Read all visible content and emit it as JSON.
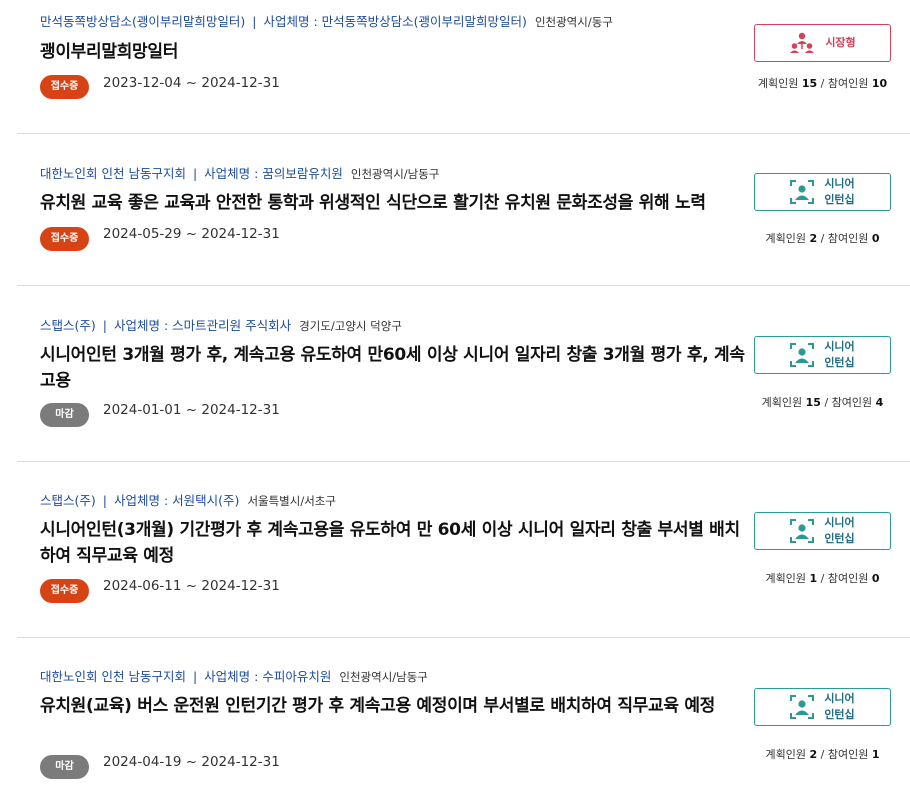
{
  "items": [
    {
      "org": "만석동쪽방상담소(괭이부리말희망일터)",
      "company_label": "사업체명",
      "company": "만석동쪽방상담소(괭이부리말희망일터)",
      "region": "인천광역시/동구",
      "title": "괭이부리말희망일터",
      "status": "접수중",
      "period": "2023-12-04 ~ 2024-12-31",
      "type": "시장형",
      "planned_label": "계획인원",
      "planned": "15",
      "joined_label": "참여인원",
      "joined": "10"
    },
    {
      "org": "대한노인회 인천 남동구지회",
      "company_label": "사업체명",
      "company": "꿈의보람유치원",
      "region": "인천광역시/남동구",
      "title": "유치원 교육 좋은 교육과 안전한 통학과 위생적인 식단으로 활기찬 유치원 문화조성을 위해 노력",
      "status": "접수중",
      "period": "2024-05-29 ~ 2024-12-31",
      "type_line1": "시니어",
      "type_line2": "인턴십",
      "planned_label": "계획인원",
      "planned": "2",
      "joined_label": "참여인원",
      "joined": "0"
    },
    {
      "org": "스탭스(주)",
      "company_label": "사업체명",
      "company": "스마트관리원 주식회사",
      "region": "경기도/고양시 덕양구",
      "title": "시니어인턴 3개월 평가 후, 계속고용 유도하여 만60세 이상 시니어 일자리 창출 3개월 평가 후, 계속 고용",
      "status": "마감",
      "period": "2024-01-01 ~ 2024-12-31",
      "type_line1": "시니어",
      "type_line2": "인턴십",
      "planned_label": "계획인원",
      "planned": "15",
      "joined_label": "참여인원",
      "joined": "4"
    },
    {
      "org": "스탭스(주)",
      "company_label": "사업체명",
      "company": "서원택시(주)",
      "region": "서울특별시/서초구",
      "title": "시니어인턴(3개월) 기간평가 후 계속고용을 유도하여 만 60세 이상 시니어 일자리 창출 부서별 배치하여 직무교육 예정",
      "status": "접수중",
      "period": "2024-06-11 ~ 2024-12-31",
      "type_line1": "시니어",
      "type_line2": "인턴십",
      "planned_label": "계획인원",
      "planned": "1",
      "joined_label": "참여인원",
      "joined": "0"
    },
    {
      "org": "대한노인회 인천 남동구지회",
      "company_label": "사업체명",
      "company": "수피아유치원",
      "region": "인천광역시/남동구",
      "title": "유치원(교육) 버스 운전원 인턴기간 평가 후 계속고용 예정이며 부서별로 배치하여 직무교육 예정",
      "status": "마감",
      "period": "2024-04-19 ~ 2024-12-31",
      "type_line1": "시니어",
      "type_line2": "인턴십",
      "planned_label": "계획인원",
      "planned": "2",
      "joined_label": "참여인원",
      "joined": "1"
    }
  ],
  "colors": {
    "link_blue": "#1e4c9a",
    "status_open": "#d64415",
    "status_closed": "#7b7b7b",
    "market_accent": "#d6405a",
    "intern_accent": "#2a9a93"
  },
  "icons": {
    "market": "people-network-icon",
    "intern": "person-frame-icon"
  }
}
